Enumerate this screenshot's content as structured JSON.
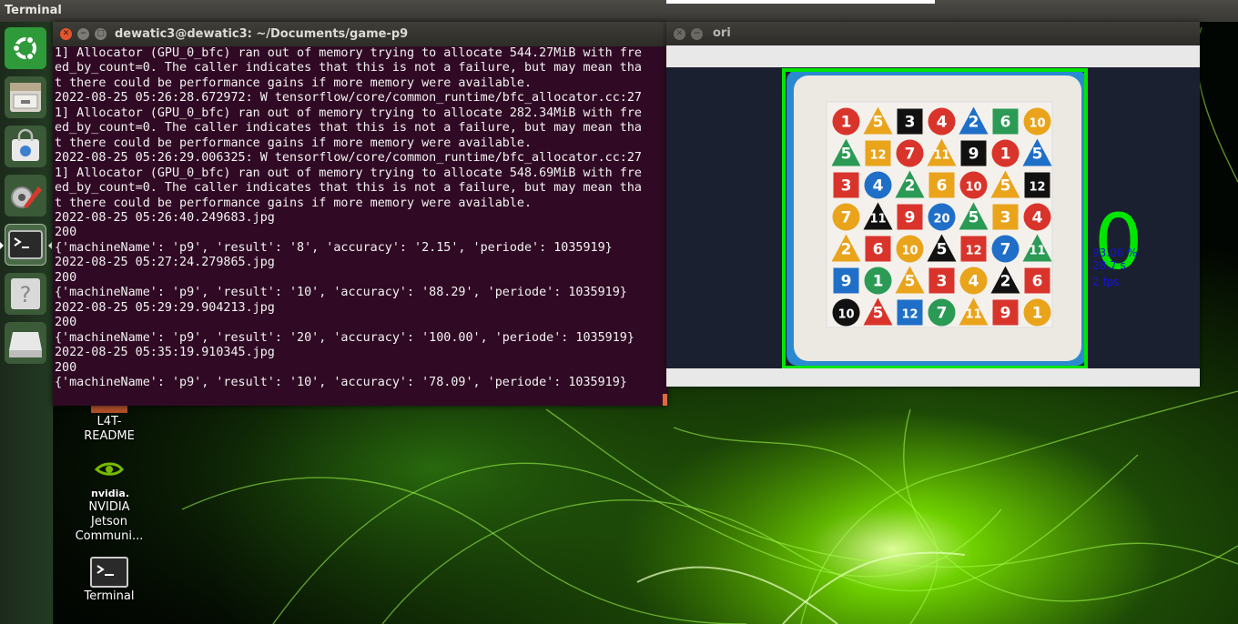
{
  "top_panel": {
    "app_title": "Terminal"
  },
  "launcher": {
    "items": [
      {
        "name": "ubuntu-dash",
        "icon": "ubuntu-logo-icon"
      },
      {
        "name": "files",
        "icon": "file-cabinet-icon"
      },
      {
        "name": "software-center",
        "icon": "shopping-bag-icon"
      },
      {
        "name": "system-settings",
        "icon": "wrench-gear-icon"
      },
      {
        "name": "terminal",
        "icon": "terminal-icon",
        "active": true
      },
      {
        "name": "help",
        "icon": "question-mark-icon"
      },
      {
        "name": "drive",
        "icon": "drive-icon"
      }
    ]
  },
  "desktop_icons": [
    {
      "label_lines": [
        "L4T-",
        "README"
      ],
      "icon": "text-file-icon"
    },
    {
      "label_lines": [
        "NVIDIA",
        "Jetson",
        "Communi..."
      ],
      "icon": "nvidia-logo-icon",
      "logo_text": "nvidia."
    },
    {
      "label_lines": [
        "Terminal"
      ],
      "icon": "terminal-icon"
    }
  ],
  "terminal": {
    "title": "dewatic3@dewatic3: ~/Documents/game-p9",
    "lines": [
      "1] Allocator (GPU_0_bfc) ran out of memory trying to allocate 544.27MiB with fre",
      "ed_by_count=0. The caller indicates that this is not a failure, but may mean tha",
      "t there could be performance gains if more memory were available.",
      "2022-08-25 05:26:28.672972: W tensorflow/core/common_runtime/bfc_allocator.cc:27",
      "1] Allocator (GPU_0_bfc) ran out of memory trying to allocate 282.34MiB with fre",
      "ed_by_count=0. The caller indicates that this is not a failure, but may mean tha",
      "t there could be performance gains if more memory were available.",
      "2022-08-25 05:26:29.006325: W tensorflow/core/common_runtime/bfc_allocator.cc:27",
      "1] Allocator (GPU_0_bfc) ran out of memory trying to allocate 548.69MiB with fre",
      "ed_by_count=0. The caller indicates that this is not a failure, but may mean tha",
      "t there could be performance gains if more memory were available.",
      "2022-08-25 05:26:40.249683.jpg",
      "200",
      "{'machineName': 'p9', 'result': '8', 'accuracy': '2.15', 'periode': 1035919}",
      "2022-08-25 05:27:24.279865.jpg",
      "200",
      "{'machineName': 'p9', 'result': '10', 'accuracy': '88.29', 'periode': 1035919}",
      "2022-08-25 05:29:29.904213.jpg",
      "200",
      "{'machineName': 'p9', 'result': '20', 'accuracy': '100.00', 'periode': 1035919}",
      "2022-08-25 05:35:19.910345.jpg",
      "200",
      "{'machineName': 'p9', 'result': '10', 'accuracy': '78.09', 'periode': 1035919}"
    ]
  },
  "ori_window": {
    "title": "ori",
    "score": "0",
    "info_lines": [
      "93.06 %",
      "28.7 s",
      "2 fps"
    ],
    "board_numbers": [
      [
        "1",
        "5",
        "3",
        "4",
        "2",
        "6",
        "10"
      ],
      [
        "5",
        "12",
        "7",
        "11",
        "9",
        "1",
        "5"
      ],
      [
        "3",
        "4",
        "2",
        "6",
        "10",
        "5",
        "12"
      ],
      [
        "7",
        "11",
        "9",
        "20",
        "5",
        "3",
        "4"
      ],
      [
        "2",
        "6",
        "10",
        "5",
        "12",
        "7",
        "11"
      ],
      [
        "9",
        "1",
        "5",
        "3",
        "4",
        "2",
        "6"
      ],
      [
        "10",
        "5",
        "12",
        "7",
        "11",
        "9",
        "1"
      ]
    ],
    "colors": {
      "detection_box": "#00e600",
      "score_text": "#00e600",
      "info_text": "#1414d8"
    }
  }
}
